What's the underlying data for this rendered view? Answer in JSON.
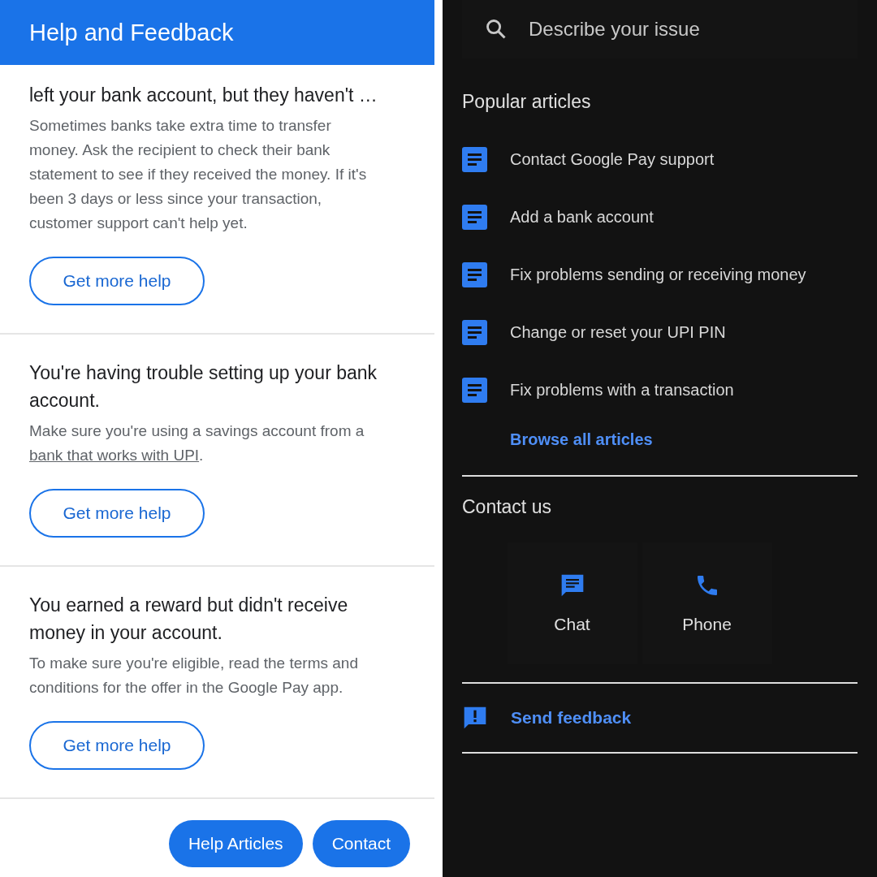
{
  "left": {
    "title": "Help and Feedback",
    "items": [
      {
        "title": "left your bank account, but they haven't …",
        "description": "Sometimes banks take extra time to transfer money. Ask the recipient to check their bank statement to see if they received the money. If it's been 3 days or less since your transaction, customer support can't help yet.",
        "button": "Get more help"
      },
      {
        "title": "You're having trouble setting up your bank account.",
        "description": "Make sure you're using a savings account from a",
        "link": "bank that works with UPI",
        "tail": ".",
        "button": "Get more help"
      },
      {
        "title": "You earned a reward but didn't receive money in your account.",
        "description": "To make sure you're eligible, read the terms and conditions for the offer in the Google Pay app.",
        "button": "Get more help"
      }
    ],
    "actions": [
      "Help Articles",
      "Contact"
    ]
  },
  "right": {
    "search": {
      "placeholder": "Describe your issue"
    },
    "popular_title": "Popular articles",
    "articles": [
      "Contact Google Pay support",
      "Add a bank account",
      "Fix problems sending or receiving money",
      "Change or reset your UPI PIN",
      "Fix problems with a transaction"
    ],
    "browse": "Browse all articles",
    "contact_title": "Contact us",
    "contacts": [
      {
        "kind": "chat",
        "label": "Chat"
      },
      {
        "kind": "phone",
        "label": "Phone"
      }
    ],
    "feedback": "Send feedback"
  }
}
